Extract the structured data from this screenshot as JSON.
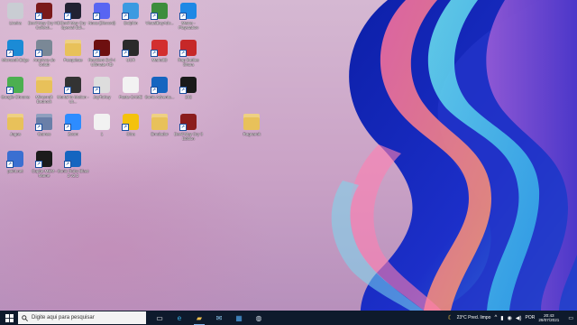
{
  "desktop_icons": [
    {
      "id": "recycle-bin",
      "label": "Lixeira",
      "color": "#c9cdd3",
      "icon": "trash-icon",
      "sc": false
    },
    {
      "id": "game1",
      "label": "Devil May Cry HD Collecti...",
      "color": "#7a1a1a",
      "icon": "game-icon",
      "sc": true
    },
    {
      "id": "game2",
      "label": "Devil May Cry Special Edi...",
      "color": "#222233",
      "icon": "game-icon",
      "sc": true
    },
    {
      "id": "discord",
      "label": "Nova (Discord)",
      "color": "#5865f2",
      "icon": "discord-icon",
      "sc": true
    },
    {
      "id": "dolphin",
      "label": "Dolphin",
      "color": "#3b9ae1",
      "icon": "dolphin-icon",
      "sc": true
    },
    {
      "id": "vbam",
      "label": "VisualBoyAdv...",
      "color": "#3c8d3c",
      "icon": "emulator-icon",
      "sc": true
    },
    {
      "id": "mame",
      "label": "Mame - Playstation",
      "color": "#1e88e5",
      "icon": "m-icon",
      "sc": true
    },
    {
      "id": "edge",
      "label": "Microsoft Edge",
      "color": "#1b8bd6",
      "icon": "edge-icon",
      "sc": true
    },
    {
      "id": "archive",
      "label": "Arquivos do Colab",
      "color": "#7a8896",
      "icon": "archive-icon",
      "sc": true
    },
    {
      "id": "folder1",
      "label": "Pesquisas",
      "color": "#e8c15a",
      "icon": "folder-icon",
      "sc": false
    },
    {
      "id": "resident",
      "label": "Resident Evil 4 Ultimate HD",
      "color": "#6e1010",
      "icon": "game-icon",
      "sc": true
    },
    {
      "id": "ucr",
      "label": "UCR",
      "color": "#2a2a2a",
      "icon": "ucr-icon",
      "sc": true
    },
    {
      "id": "mario",
      "label": "Mario3D",
      "color": "#d32f2f",
      "icon": "mushroom-icon",
      "sc": true
    },
    {
      "id": "rpgs",
      "label": "Rap Battles Shura",
      "color": "#c62828",
      "icon": "rs-icon",
      "sc": true
    },
    {
      "id": "chrome",
      "label": "Google Chrome",
      "color": "#4caf50",
      "icon": "chrome-icon",
      "sc": true
    },
    {
      "id": "folder2",
      "label": "Minecraft Bedrock",
      "color": "#e8c15a",
      "icon": "folder-icon",
      "sc": false
    },
    {
      "id": "obs",
      "label": "Mortal In Motion - Ut...",
      "color": "#333333",
      "icon": "obs-icon",
      "sc": true
    },
    {
      "id": "joy",
      "label": "JoyToKey",
      "color": "#dddddd",
      "icon": "gamepad-icon",
      "sc": true
    },
    {
      "id": "folder3",
      "label": "Pasta GAME",
      "color": "#f2f2f2",
      "icon": "file-icon",
      "sc": false
    },
    {
      "id": "sonic",
      "label": "Sonic Adventu...",
      "color": "#1565c0",
      "icon": "dx-icon",
      "sc": true
    },
    {
      "id": "zx",
      "label": "232",
      "color": "#1a1a1a",
      "icon": "game-icon",
      "sc": true
    },
    {
      "id": "jogos",
      "label": "Jogos",
      "color": "#e8c15a",
      "icon": "folder-icon",
      "sc": false
    },
    {
      "id": "games",
      "label": "Games",
      "color": "#6a7fa8",
      "icon": "folder-icon",
      "sc": true
    },
    {
      "id": "zoom",
      "label": "Zoom",
      "color": "#2d8cff",
      "icon": "zoom-icon",
      "sc": true
    },
    {
      "id": "file1",
      "label": "1",
      "color": "#f2f2f2",
      "icon": "file-icon",
      "sc": false
    },
    {
      "id": "citra",
      "label": "Citra",
      "color": "#f4c20d",
      "icon": "citra-icon",
      "sc": true
    },
    {
      "id": "folder4",
      "label": "Emulador",
      "color": "#e8c15a",
      "icon": "folder-icon",
      "sc": false
    },
    {
      "id": "dmc3",
      "label": "Devil May Cry 3 Edition",
      "color": "#8b1d1d",
      "icon": "game-icon",
      "sc": true
    },
    {
      "id": "ragnar",
      "label": "Ragnarok",
      "color": "#e8c15a",
      "icon": "folder-icon",
      "sc": false
    },
    {
      "id": "paint",
      "label": "paint.net",
      "color": "#3a6fd1",
      "icon": "paint-icon",
      "sc": true
    },
    {
      "id": "pacman",
      "label": "Cuphe MEM - Mame",
      "color": "#1b1b1b",
      "icon": "arcade-icon",
      "sc": true
    },
    {
      "id": "sonicr",
      "label": "Sonic Robo Blast 2 v2.2",
      "color": "#1565c0",
      "icon": "sonic-icon",
      "sc": true
    }
  ],
  "taskbar": {
    "search_placeholder": "Digite aqui para pesquisar",
    "pinned": [
      {
        "name": "task-view-icon",
        "char": "▭",
        "color": "#ffffff"
      },
      {
        "name": "edge-icon",
        "char": "e",
        "color": "#37b3e8"
      },
      {
        "name": "file-explorer-icon",
        "char": "▰",
        "color": "#f2c14e"
      },
      {
        "name": "mail-icon",
        "char": "✉",
        "color": "#8ecbf2"
      },
      {
        "name": "store-icon",
        "char": "▦",
        "color": "#4ea3e8"
      },
      {
        "name": "steam-icon",
        "char": "◍",
        "color": "#cfd8e3"
      }
    ],
    "weather_text": "23°C  Pred. limpo",
    "language": "POR",
    "time": "20:43",
    "date": "29/07/2021"
  }
}
